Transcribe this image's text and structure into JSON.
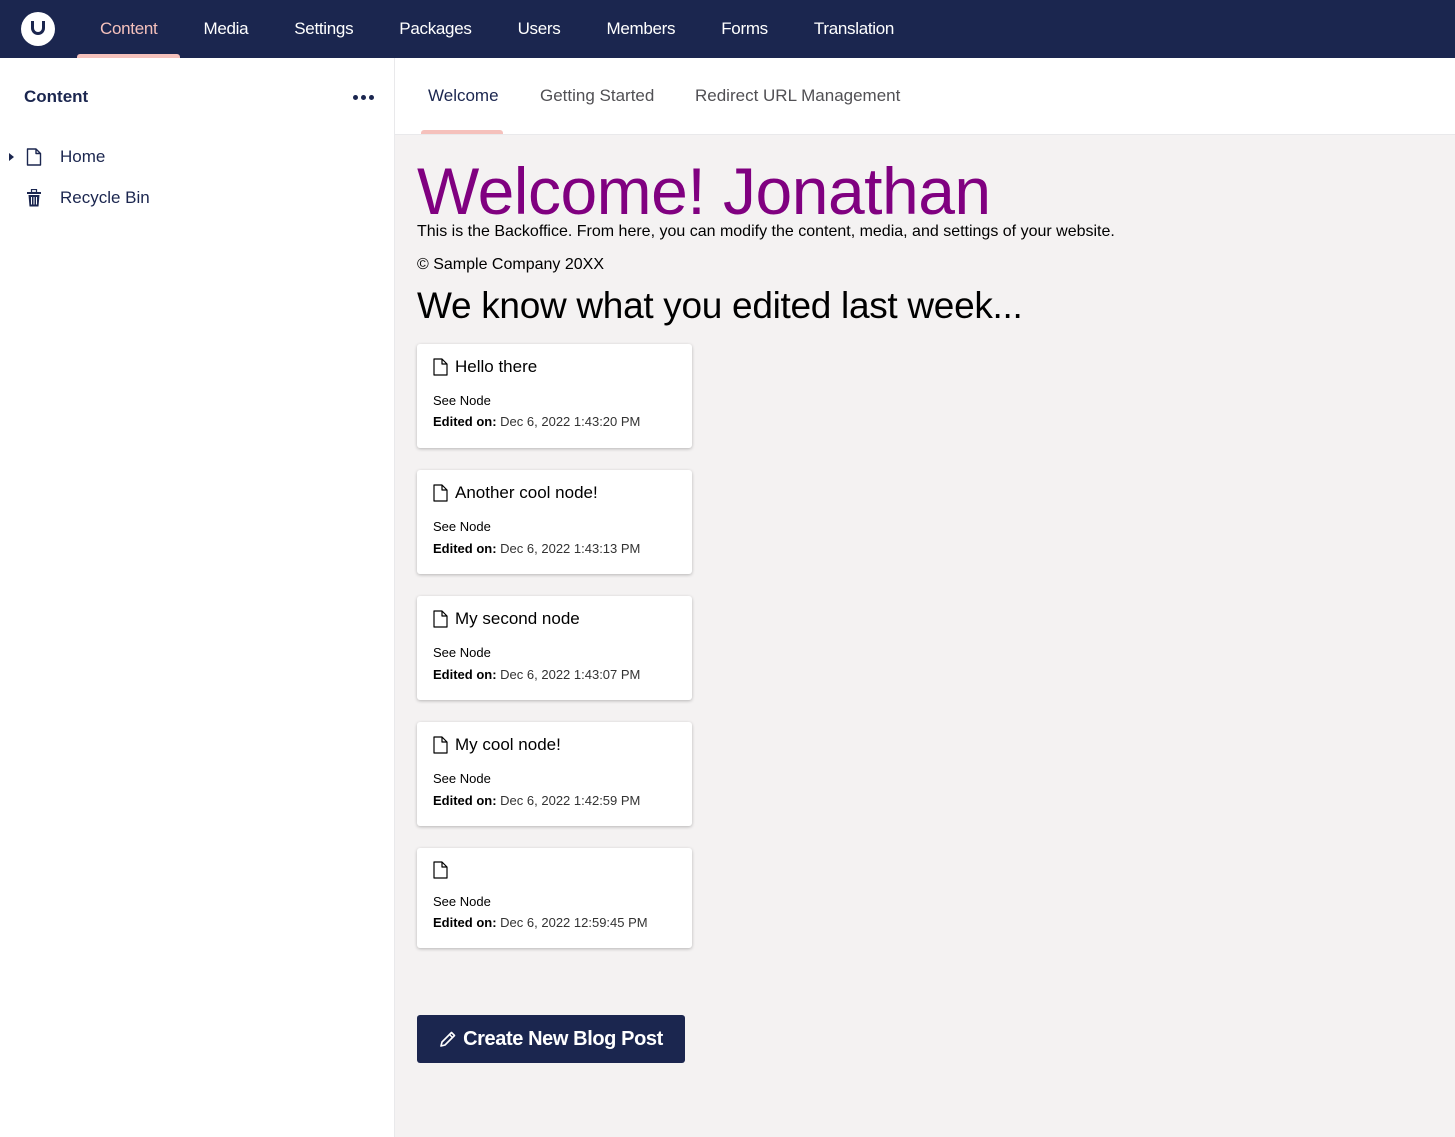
{
  "topbar": {
    "logo_icon": "umbraco-logo-icon",
    "nav": [
      {
        "label": "Content",
        "active": true
      },
      {
        "label": "Media"
      },
      {
        "label": "Settings"
      },
      {
        "label": "Packages"
      },
      {
        "label": "Users"
      },
      {
        "label": "Members"
      },
      {
        "label": "Forms"
      },
      {
        "label": "Translation"
      }
    ]
  },
  "sidebar": {
    "title": "Content",
    "menu_icon": "more-dots-icon",
    "items": [
      {
        "label": "Home",
        "icon": "document-icon",
        "expandable": true
      },
      {
        "label": "Recycle Bin",
        "icon": "trash-icon"
      }
    ]
  },
  "tabs": [
    {
      "label": "Welcome",
      "active": true
    },
    {
      "label": "Getting Started"
    },
    {
      "label": "Redirect URL Management"
    }
  ],
  "main": {
    "welcome": "Welcome! Jonathan",
    "intro": "This is the Backoffice. From here, you can modify the content, media, and settings of your website.",
    "copyright": "© Sample Company 20XX",
    "heading": "We know what you edited last week...",
    "edited_label": "Edited on:",
    "cards": [
      {
        "title": "Hello there",
        "link": "See Node",
        "edited": "Dec 6, 2022 1:43:20 PM"
      },
      {
        "title": "Another cool node!",
        "link": "See Node",
        "edited": "Dec 6, 2022 1:43:13 PM"
      },
      {
        "title": "My second node",
        "link": "See Node",
        "edited": "Dec 6, 2022 1:43:07 PM"
      },
      {
        "title": "My cool node!",
        "link": "See Node",
        "edited": "Dec 6, 2022 1:42:59 PM"
      },
      {
        "title": "",
        "link": "See Node",
        "edited": "Dec 6, 2022 12:59:45 PM"
      }
    ],
    "create_button": "Create New Blog Post",
    "create_icon": "pencil-icon"
  },
  "colors": {
    "header_bg": "#1b264f",
    "accent": "#f5c1bc",
    "welcome_text": "#800080",
    "content_bg": "#f4f2f2"
  }
}
